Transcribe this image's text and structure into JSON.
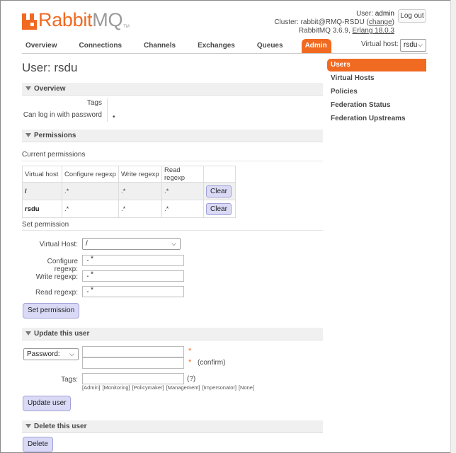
{
  "app": {
    "logo_r": "Rabbit",
    "logo_mq": "MQ",
    "logo_tm": "TM"
  },
  "header": {
    "user_prefix": "User: ",
    "user": "admin",
    "cluster_prefix": "Cluster: ",
    "cluster": "rabbit@RMQ-RSDU",
    "change_link": "change",
    "version": "RabbitMQ 3.6.9, ",
    "erlang": "Erlang 18.0.3",
    "logout": "Log out"
  },
  "tabs": [
    "Overview",
    "Connections",
    "Channels",
    "Exchanges",
    "Queues",
    "Admin"
  ],
  "active_tab": "Admin",
  "vhost": {
    "label": "Virtual host:",
    "value": "rsdu"
  },
  "sidebar": [
    "Users",
    "Virtual Hosts",
    "Policies",
    "Federation Status",
    "Federation Upstreams"
  ],
  "page": {
    "title": "User: rsdu"
  },
  "overview": {
    "section": "Overview",
    "tags_label": "Tags",
    "login_label": "Can log in with password",
    "login_value": "•"
  },
  "permissions": {
    "section": "Permissions",
    "current_label": "Current permissions",
    "columns": [
      "Virtual host",
      "Configure regexp",
      "Write regexp",
      "Read regexp"
    ],
    "rows": [
      {
        "vhost": "/",
        "configure": ".*",
        "write": ".*",
        "read": ".*",
        "action": "Clear"
      },
      {
        "vhost": "rsdu",
        "configure": ".*",
        "write": ".*",
        "read": ".*",
        "action": "Clear"
      }
    ],
    "set_label": "Set permission",
    "vhost_field_label": "Virtual Host:",
    "vhost_field_value": "/",
    "configure_label": "Configure regexp:",
    "configure_value": ".*",
    "write_label": "Write regexp:",
    "write_value": ".*",
    "read_label": "Read regexp:",
    "read_value": ".*",
    "submit": "Set permission"
  },
  "update": {
    "section": "Update this user",
    "password_select": "Password:",
    "required": "*",
    "confirm": "(confirm)",
    "tags_label": "Tags:",
    "tags_help": "(?)",
    "tag_options": [
      "[Admin]",
      "[Monitoring]",
      "[Policymaker]",
      "[Management]",
      "[Impersonator]",
      "[None]"
    ],
    "submit": "Update user"
  },
  "delete": {
    "section": "Delete this user",
    "submit": "Delete"
  },
  "colors": {
    "accent": "#f16a21",
    "button": "#dadaf6",
    "section_bg": "#f0f0f0"
  }
}
